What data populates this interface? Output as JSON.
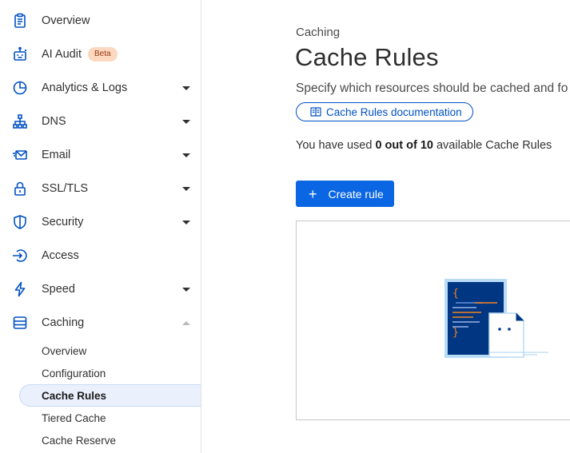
{
  "sidebar": {
    "items": [
      {
        "label": "Overview",
        "icon": "clipboard-icon"
      },
      {
        "label": "AI Audit",
        "icon": "robot-icon",
        "badge": "Beta"
      },
      {
        "label": "Analytics & Logs",
        "icon": "pie-chart-icon"
      },
      {
        "label": "DNS",
        "icon": "network-icon"
      },
      {
        "label": "Email",
        "icon": "envelope-icon"
      },
      {
        "label": "SSL/TLS",
        "icon": "lock-icon"
      },
      {
        "label": "Security",
        "icon": "shield-icon"
      },
      {
        "label": "Access",
        "icon": "access-arrow-icon"
      },
      {
        "label": "Speed",
        "icon": "lightning-icon"
      },
      {
        "label": "Caching",
        "icon": "server-stack-icon"
      }
    ],
    "caching_subitems": [
      {
        "label": "Overview"
      },
      {
        "label": "Configuration"
      },
      {
        "label": "Cache Rules",
        "active": true
      },
      {
        "label": "Tiered Cache"
      },
      {
        "label": "Cache Reserve"
      }
    ]
  },
  "main": {
    "eyebrow": "Caching",
    "title": "Cache Rules",
    "description": "Specify which resources should be cached and fo",
    "doc_link_label": "Cache Rules documentation",
    "usage": {
      "prefix": "You have used ",
      "used": "0 out of 10",
      "suffix": " available Cache Rules"
    },
    "create_button_label": "Create rule"
  },
  "colors": {
    "accent": "#0051c3",
    "button": "#0b66e4",
    "active_bg": "#eaf1fd",
    "badge_bg": "#fbd8bf"
  }
}
